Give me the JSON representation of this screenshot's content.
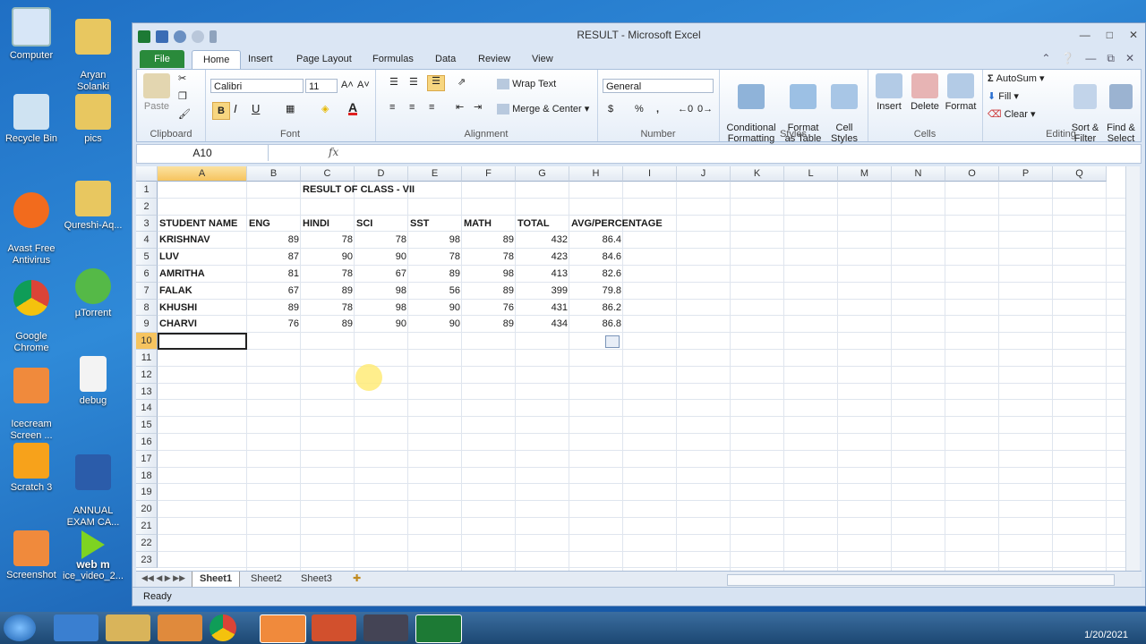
{
  "desktop": {
    "icons": [
      {
        "label": "Computer"
      },
      {
        "label": "Aryan\nSolanki"
      },
      {
        "label": "Recycle Bin"
      },
      {
        "label": "pics"
      },
      {
        "label": "Avast Free\nAntivirus"
      },
      {
        "label": "Qureshi-Aq..."
      },
      {
        "label": "Google\nChrome"
      },
      {
        "label": "µTorrent"
      },
      {
        "label": "Icecream\nScreen ..."
      },
      {
        "label": "debug"
      },
      {
        "label": "Scratch 3"
      },
      {
        "label": "ANNUAL\nEXAM CA..."
      },
      {
        "label": "Screenshot"
      },
      {
        "label": "ice_video_2..."
      }
    ],
    "webm_label": "web m"
  },
  "window": {
    "title": "RESULT - Microsoft Excel",
    "tabs": [
      "File",
      "Home",
      "Insert",
      "Page Layout",
      "Formulas",
      "Data",
      "Review",
      "View"
    ]
  },
  "ribbon": {
    "clipboard": {
      "paste": "Paste",
      "label": "Clipboard"
    },
    "font": {
      "name": "Calibri",
      "size": "11",
      "label": "Font",
      "bold": "B",
      "italic": "I",
      "underline": "U"
    },
    "alignment": {
      "wrap": "Wrap Text",
      "merge": "Merge & Center",
      "label": "Alignment"
    },
    "number": {
      "format": "General",
      "label": "Number",
      "currency": "$",
      "percent": "%",
      "comma": ","
    },
    "styles": {
      "conditional": "Conditional\nFormatting",
      "table": "Format\nas Table",
      "cell": "Cell\nStyles",
      "label": "Styles"
    },
    "cells": {
      "insert": "Insert",
      "delete": "Delete",
      "format": "Format",
      "label": "Cells"
    },
    "editing": {
      "autosum": "AutoSum",
      "fill": "Fill",
      "clear": "Clear",
      "sort": "Sort &\nFilter",
      "find": "Find &\nSelect",
      "label": "Editing"
    }
  },
  "formula_bar": {
    "name_box": "A10",
    "fx": "fx",
    "value": ""
  },
  "columns": [
    "A",
    "B",
    "C",
    "D",
    "E",
    "F",
    "G",
    "H",
    "I",
    "J",
    "K",
    "L",
    "M",
    "N",
    "O",
    "P",
    "Q"
  ],
  "rows": [
    "1",
    "2",
    "3",
    "4",
    "5",
    "6",
    "7",
    "8",
    "9",
    "10",
    "11",
    "12",
    "13",
    "14",
    "15",
    "16",
    "17",
    "18",
    "19",
    "20",
    "21",
    "22",
    "23"
  ],
  "sheet": {
    "title": "RESULT OF CLASS - VII",
    "headers": [
      "STUDENT NAME",
      "ENG",
      "HINDI",
      "SCI",
      "SST",
      "MATH",
      "TOTAL",
      "AVG/PERCENTAGE"
    ],
    "data": [
      [
        "KRISHNAV",
        "89",
        "78",
        "78",
        "98",
        "89",
        "432",
        "86.4"
      ],
      [
        "LUV",
        "87",
        "90",
        "90",
        "78",
        "78",
        "423",
        "84.6"
      ],
      [
        "AMRITHA",
        "81",
        "78",
        "67",
        "89",
        "98",
        "413",
        "82.6"
      ],
      [
        "FALAK",
        "67",
        "89",
        "98",
        "56",
        "89",
        "399",
        "79.8"
      ],
      [
        "KHUSHI",
        "89",
        "78",
        "98",
        "90",
        "76",
        "431",
        "86.2"
      ],
      [
        "CHARVI",
        "76",
        "89",
        "90",
        "90",
        "89",
        "434",
        "86.8"
      ]
    ]
  },
  "sheet_tabs": [
    "Sheet1",
    "Sheet2",
    "Sheet3"
  ],
  "status": {
    "ready": "Ready"
  },
  "taskbar": {
    "date": "1/20/2021"
  },
  "colors": {
    "accent": "#2a8a3b",
    "selected_header": "#f6c45f",
    "desktop": "#2f8ad8"
  }
}
